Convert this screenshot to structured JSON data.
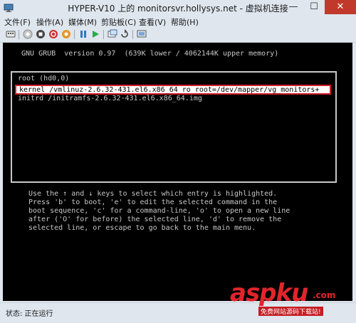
{
  "window": {
    "title": "HYPER-V10 上的 monitorsvr.hollysys.net - 虚拟机连接",
    "minimize": "—",
    "maximize": "☐",
    "close": "✕"
  },
  "menu": [
    "文件(F)",
    "操作(A)",
    "媒体(M)",
    "剪贴板(C)",
    "查看(V)",
    "帮助(H)"
  ],
  "toolbar_icons": [
    "ctrl-alt-del-icon",
    "start-icon",
    "stop-icon",
    "shutdown-icon",
    "save-icon",
    "pause-icon",
    "resume-icon",
    "checkpoint-icon",
    "revert-icon",
    "enhanced-session-icon"
  ],
  "grub": {
    "header": "GNU GRUB  version 0.97  (639K lower / 4062144K upper memory)",
    "entries": [
      "root (hd0,0)",
      "kernel /vmlinuz-2.6.32-431.el6.x86_64 ro root=/dev/mapper/vg_monitors+",
      "initrd /initramfs-2.6.32-431.el6.x86_64.img"
    ],
    "selected_index": 1,
    "instructions": [
      "Use the ↑ and ↓ keys to select which entry is highlighted.",
      "Press 'b' to boot, 'e' to edit the selected command in the",
      "boot sequence, 'c' for a command-line, 'o' to open a new line",
      "after ('O' for before) the selected line, 'd' to remove the",
      "selected line, or escape to go back to the main menu."
    ]
  },
  "status": "状态: 正在运行",
  "watermark": {
    "main": "aspku",
    "sub": ".com",
    "caption": "免费网站源码下载站!"
  },
  "colors": {
    "chrome": "#dfe6ee",
    "console_bg": "#000000",
    "console_text": "#c8c8c8",
    "highlight_border": "#d2202a",
    "close_button": "#c0392b",
    "watermark": "#e1252b"
  }
}
